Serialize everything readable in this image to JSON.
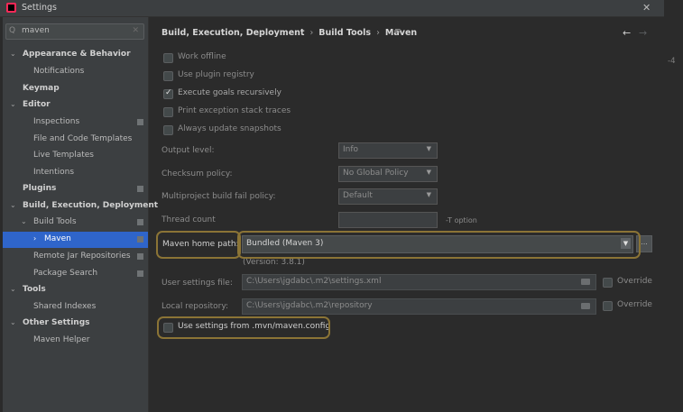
{
  "window": {
    "title": "Settings",
    "close_glyph": "✕"
  },
  "outer_right_text": "-4",
  "search": {
    "value": "maven",
    "icon": "search-icon",
    "clear_glyph": "✕"
  },
  "sidebar": {
    "items": [
      {
        "label": "Appearance & Behavior",
        "expanded": true,
        "bold": true
      },
      {
        "label": "Notifications"
      },
      {
        "label": "Keymap",
        "bold": true
      },
      {
        "label": "Editor",
        "expanded": true,
        "bold": true
      },
      {
        "label": "Inspections",
        "badge": true
      },
      {
        "label": "File and Code Templates"
      },
      {
        "label": "Live Templates"
      },
      {
        "label": "Intentions"
      },
      {
        "label": "Plugins",
        "bold": true,
        "badge": true
      },
      {
        "label": "Build, Execution, Deployment",
        "expanded": true,
        "bold": true
      },
      {
        "label": "Build Tools",
        "expanded": true,
        "badge": true
      },
      {
        "label": "Maven",
        "selected": true,
        "badge": true
      },
      {
        "label": "Remote Jar Repositories",
        "badge": true
      },
      {
        "label": "Package Search",
        "badge": true
      },
      {
        "label": "Tools",
        "expanded": true,
        "bold": true
      },
      {
        "label": "Shared Indexes"
      },
      {
        "label": "Other Settings",
        "expanded": true,
        "bold": true
      },
      {
        "label": "Maven Helper"
      }
    ]
  },
  "breadcrumb": {
    "parts": [
      "Build, Execution, Deployment",
      "Build Tools",
      "Maven"
    ],
    "separator": "›",
    "menu_glyph": "≡",
    "back_glyph": "←",
    "forward_glyph": "→"
  },
  "checkboxes": [
    {
      "label": "Work offline",
      "checked": false
    },
    {
      "label": "Use plugin registry",
      "checked": false
    },
    {
      "label": "Execute goals recursively",
      "checked": true
    },
    {
      "label": "Print exception stack traces",
      "checked": false
    },
    {
      "label": "Always update snapshots",
      "checked": false
    }
  ],
  "fields": {
    "output_level": {
      "label": "Output level:",
      "value": "Info"
    },
    "checksum_policy": {
      "label": "Checksum policy:",
      "value": "No Global Policy"
    },
    "fail_policy": {
      "label": "Multiproject build fail policy:",
      "value": "Default"
    },
    "thread_count": {
      "label": "Thread count",
      "value": "",
      "hint": "-T option"
    },
    "maven_home": {
      "label": "Maven home path:",
      "value": "Bundled (Maven 3)",
      "version": "(Version: 3.8.1)",
      "browse_glyph": "..."
    },
    "user_settings": {
      "label": "User settings file:",
      "value": "C:\\Users\\jgdabc\\.m2\\settings.xml",
      "override_label": "Override"
    },
    "local_repo": {
      "label": "Local repository:",
      "value": "C:\\Users\\jgdabc\\.m2\\repository",
      "override_label": "Override"
    }
  },
  "mvn_config": {
    "label": "Use settings from .mvn/maven.config",
    "checked": false
  },
  "glyphs": {
    "caret_down": "▼",
    "expanded_arrow": "⌄",
    "collapsed_arrow": "›",
    "tick": "✓"
  },
  "colors": {
    "accent_selection": "#2f65ca",
    "highlight_outline": "#8b7436",
    "background": "#2b2b2b",
    "sidebar": "#3c3f41"
  }
}
